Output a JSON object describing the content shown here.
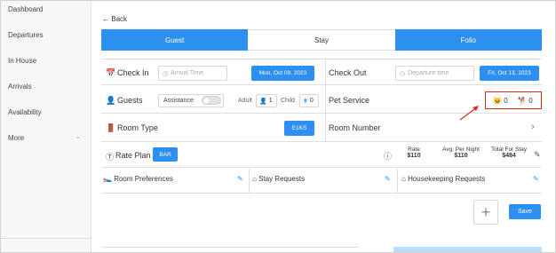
{
  "sidebar": {
    "items": [
      "Dashboard",
      "Departures",
      "In House",
      "Arrivals",
      "Availability",
      "More"
    ]
  },
  "back_label": "Back",
  "tabs": [
    "Guest",
    "Stay",
    "Folio"
  ],
  "check_in": {
    "label": "Check In",
    "placeholder": "Arrival Time",
    "date": "Mon, Oct 09, 2023"
  },
  "check_out": {
    "label": "Check Out",
    "placeholder": "Departure time",
    "date": "Fri, Oct 13, 2023"
  },
  "guests": {
    "label": "Guests",
    "assistance": "Assistance",
    "adult_label": "Adult",
    "adult_count": "1",
    "child_label": "Child",
    "child_count": "0"
  },
  "pet_service": {
    "label": "Pet Service",
    "cats": "0",
    "dogs": "0"
  },
  "room_type": {
    "label": "Room Type",
    "value": "E1KS"
  },
  "room_number": {
    "label": "Room Number"
  },
  "rate_plan": {
    "label": "Rate Plan",
    "code": "BAR",
    "rate_label": "Rate",
    "rate_value": "$110",
    "avg_label": "Avg. Per Night",
    "avg_value": "$110",
    "total_label": "Total For Stay",
    "total_value": "$484"
  },
  "prefs": {
    "room": "Room Preferences",
    "stay": "Stay Requests",
    "housekeeping": "Housekeeping Requests"
  },
  "save_label": "Save",
  "colors": {
    "accent": "#2d8ff0",
    "highlight": "#e0261f"
  }
}
